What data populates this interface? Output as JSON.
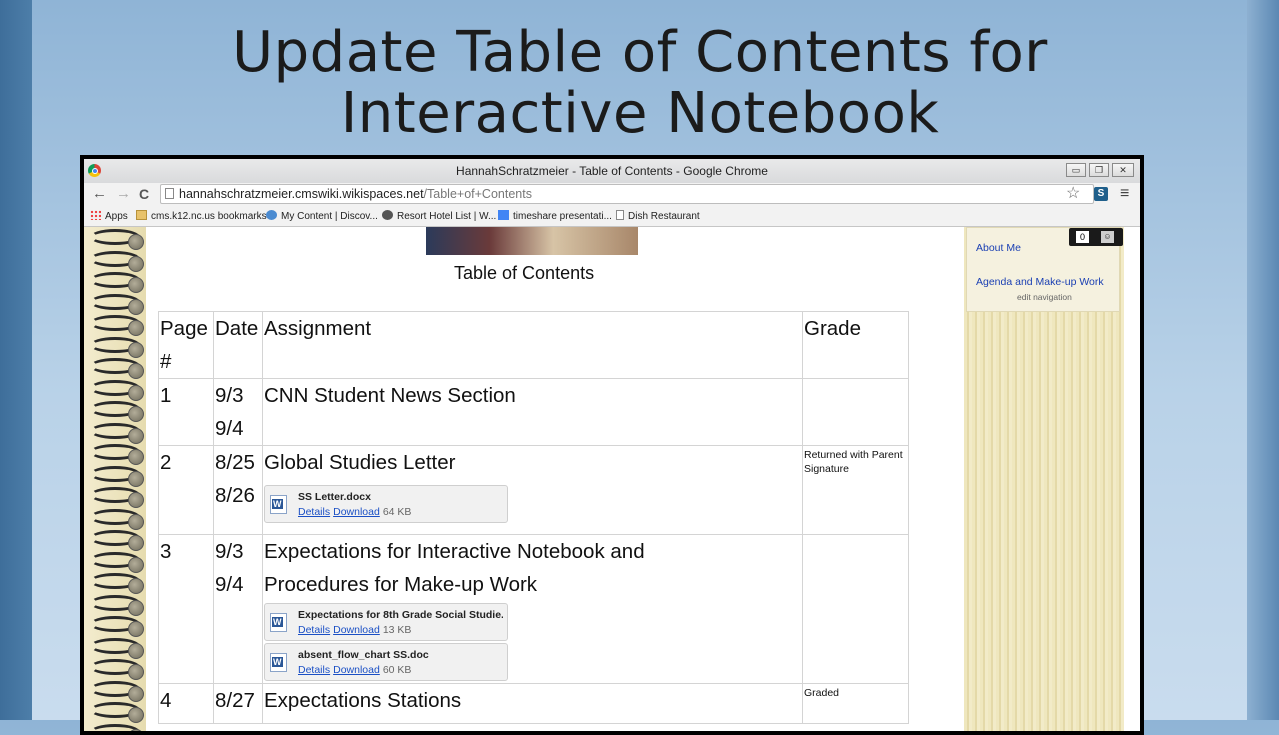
{
  "slide": {
    "title_line1": "Update Table of Contents for",
    "title_line2": "Interactive Notebook"
  },
  "window": {
    "title": "HannahSchratzmeier - Table of Contents - Google Chrome"
  },
  "toolbar": {
    "back": "←",
    "forward": "→",
    "reload": "C",
    "url_host": "hannahschratzmeier.cmswiki.wikispaces.net",
    "url_path": "/Table+of+Contents",
    "star": "☆",
    "extension": "S",
    "menu": "≡"
  },
  "bookmarks": [
    {
      "label": "Apps"
    },
    {
      "label": "cms.k12.nc.us bookmarks"
    },
    {
      "label": "My Content | Discov..."
    },
    {
      "label": "Resort Hotel List | W..."
    },
    {
      "label": "timeshare presentati..."
    },
    {
      "label": "Dish Restaurant"
    }
  ],
  "page": {
    "heading": "Table of Contents",
    "headers": {
      "page": "Page #",
      "date": "Date",
      "assignment": "Assignment",
      "grade": "Grade"
    },
    "rows": [
      {
        "page": "1",
        "date1": "9/3",
        "date2": "9/4",
        "assignment": "CNN Student News Section",
        "grade": ""
      },
      {
        "page": "2",
        "date1": "8/25",
        "date2": "8/26",
        "assignment": "Global Studies Letter",
        "grade": "Returned with Parent Signature",
        "attachments": [
          {
            "name": "SS Letter.docx",
            "details": "Details",
            "download": "Download",
            "size": "64 KB"
          }
        ]
      },
      {
        "page": "3",
        "date1": "9/3",
        "date2": "9/4",
        "assignment": "Expectations for Interactive Notebook and Procedures for Make-up Work",
        "grade": "",
        "attachments": [
          {
            "name": "Expectations for 8th Grade Social Studie...",
            "details": "Details",
            "download": "Download",
            "size": "13 KB"
          },
          {
            "name": "absent_flow_chart SS.doc",
            "details": "Details",
            "download": "Download",
            "size": "60 KB"
          }
        ]
      },
      {
        "page": "4",
        "date1": "8/27",
        "assignment": "Expectations Stations",
        "grade": "Graded"
      }
    ]
  },
  "sidebar": {
    "links": [
      "About Me",
      "Agenda and Make-up Work"
    ],
    "edit": "edit navigation",
    "counter": "0"
  },
  "winbtns": {
    "min": "▭",
    "max": "❐",
    "close": "✕"
  }
}
